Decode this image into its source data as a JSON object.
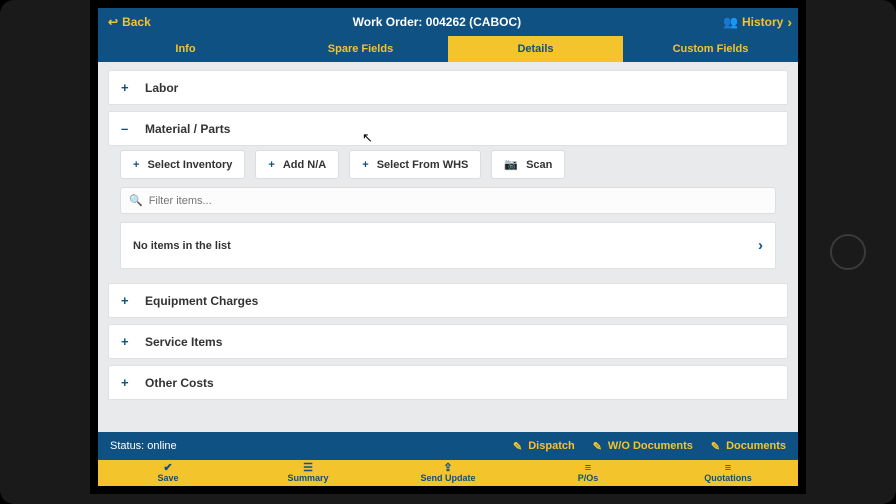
{
  "header": {
    "back": "Back",
    "title": "Work Order: 004262   (CABOC)",
    "history": "History"
  },
  "tabs": [
    {
      "label": "Info",
      "active": false
    },
    {
      "label": "Spare Fields",
      "active": false
    },
    {
      "label": "Details",
      "active": true
    },
    {
      "label": "Custom Fields",
      "active": false
    }
  ],
  "sections": {
    "labor": "Labor",
    "material": "Material / Parts",
    "equipment": "Equipment Charges",
    "service": "Service Items",
    "other": "Other Costs"
  },
  "material_actions": {
    "select_inventory": "Select Inventory",
    "add_na": "Add N/A",
    "select_whs": "Select From WHS",
    "scan": "Scan"
  },
  "material_body": {
    "filter_placeholder": "Filter items...",
    "empty_text": "No items in the list"
  },
  "status_bar": {
    "status": "Status: online",
    "dispatch": "Dispatch",
    "wo_docs": "W/O Documents",
    "documents": "Documents"
  },
  "bottom_bar": {
    "save": "Save",
    "summary": "Summary",
    "send_update": "Send Update",
    "pos": "P/Os",
    "quotations": "Quotations"
  }
}
